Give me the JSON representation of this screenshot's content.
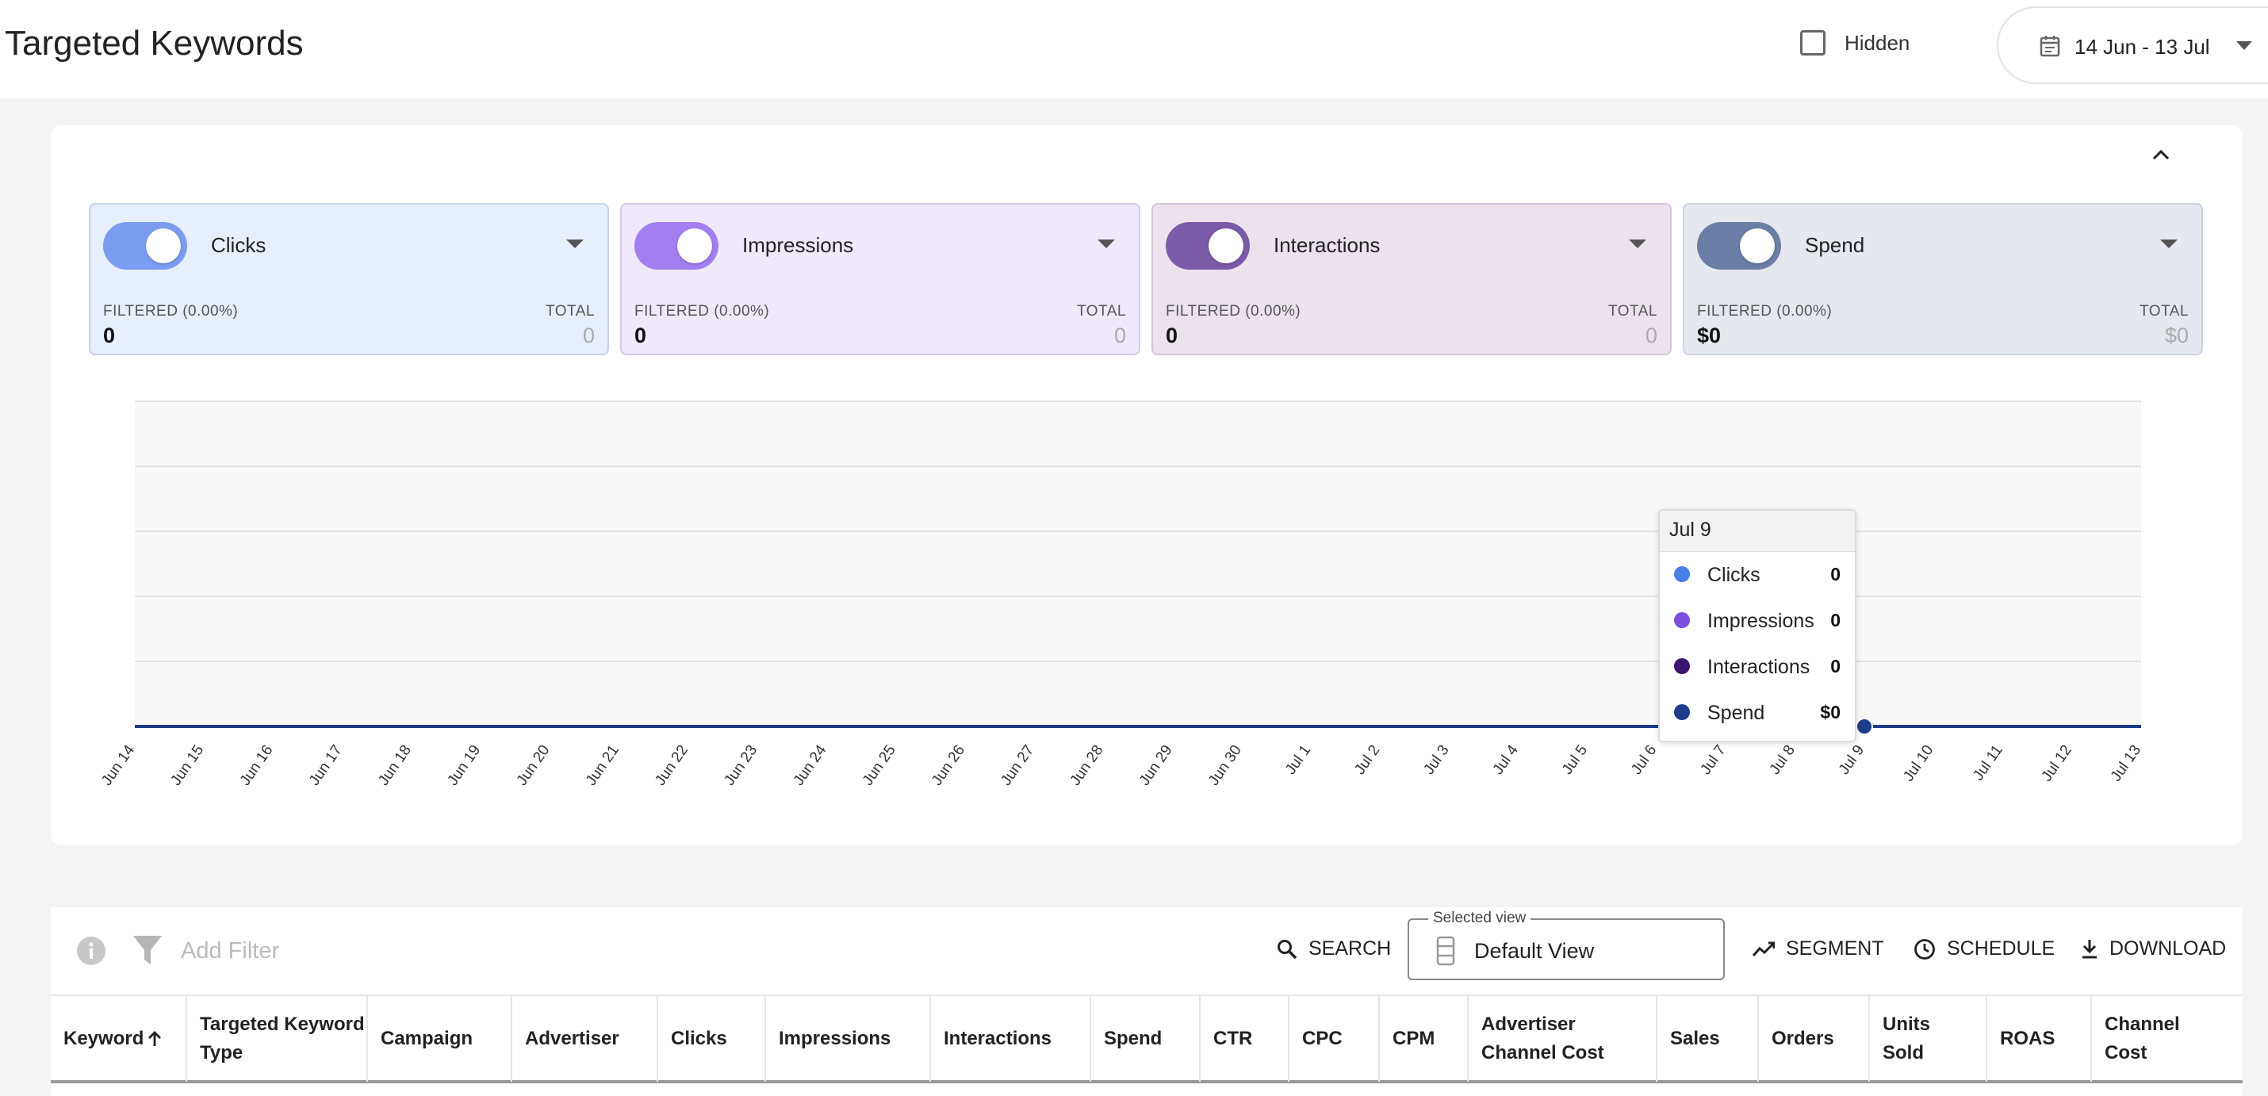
{
  "header": {
    "title": "Targeted Keywords",
    "hidden_label": "Hidden",
    "hidden_checked": false,
    "date_range": "14 Jun - 13 Jul"
  },
  "metrics": [
    {
      "name": "Clicks",
      "color": "#7b9cf0",
      "enabled": true,
      "filtered_label": "FILTERED (0.00%)",
      "filtered_value": "0",
      "total_label": "TOTAL",
      "total_value": "0"
    },
    {
      "name": "Impressions",
      "color": "#a27ff0",
      "enabled": true,
      "filtered_label": "FILTERED (0.00%)",
      "filtered_value": "0",
      "total_label": "TOTAL",
      "total_value": "0"
    },
    {
      "name": "Interactions",
      "color": "#7b5ba8",
      "enabled": true,
      "filtered_label": "FILTERED (0.00%)",
      "filtered_value": "0",
      "total_label": "TOTAL",
      "total_value": "0"
    },
    {
      "name": "Spend",
      "color": "#6b7fa6",
      "enabled": true,
      "filtered_label": "FILTERED (0.00%)",
      "filtered_value": "$0",
      "total_label": "TOTAL",
      "total_value": "$0"
    }
  ],
  "chart_data": {
    "type": "line",
    "x": [
      "Jun 14",
      "Jun 15",
      "Jun 16",
      "Jun 17",
      "Jun 18",
      "Jun 19",
      "Jun 20",
      "Jun 21",
      "Jun 22",
      "Jun 23",
      "Jun 24",
      "Jun 25",
      "Jun 26",
      "Jun 27",
      "Jun 28",
      "Jun 29",
      "Jun 30",
      "Jul 1",
      "Jul 2",
      "Jul 3",
      "Jul 4",
      "Jul 5",
      "Jul 6",
      "Jul 7",
      "Jul 8",
      "Jul 9",
      "Jul 10",
      "Jul 11",
      "Jul 12",
      "Jul 13"
    ],
    "series": [
      {
        "name": "Clicks",
        "color": "#4a7fe8",
        "values": [
          0,
          0,
          0,
          0,
          0,
          0,
          0,
          0,
          0,
          0,
          0,
          0,
          0,
          0,
          0,
          0,
          0,
          0,
          0,
          0,
          0,
          0,
          0,
          0,
          0,
          0,
          0,
          0,
          0,
          0
        ]
      },
      {
        "name": "Impressions",
        "color": "#7b4fe0",
        "values": [
          0,
          0,
          0,
          0,
          0,
          0,
          0,
          0,
          0,
          0,
          0,
          0,
          0,
          0,
          0,
          0,
          0,
          0,
          0,
          0,
          0,
          0,
          0,
          0,
          0,
          0,
          0,
          0,
          0,
          0
        ]
      },
      {
        "name": "Interactions",
        "color": "#3b1470",
        "values": [
          0,
          0,
          0,
          0,
          0,
          0,
          0,
          0,
          0,
          0,
          0,
          0,
          0,
          0,
          0,
          0,
          0,
          0,
          0,
          0,
          0,
          0,
          0,
          0,
          0,
          0,
          0,
          0,
          0,
          0
        ]
      },
      {
        "name": "Spend",
        "color": "#1e3c8a",
        "values": [
          0,
          0,
          0,
          0,
          0,
          0,
          0,
          0,
          0,
          0,
          0,
          0,
          0,
          0,
          0,
          0,
          0,
          0,
          0,
          0,
          0,
          0,
          0,
          0,
          0,
          0,
          0,
          0,
          0,
          0
        ]
      }
    ],
    "grid": true,
    "highlighted_x": "Jul 9"
  },
  "tooltip": {
    "title": "Jul 9",
    "rows": [
      {
        "label": "Clicks",
        "value": "0",
        "color": "#4a7fe8"
      },
      {
        "label": "Impressions",
        "value": "0",
        "color": "#7b4fe0"
      },
      {
        "label": "Interactions",
        "value": "0",
        "color": "#3b1470"
      },
      {
        "label": "Spend",
        "value": "$0",
        "color": "#1e3c8a"
      }
    ]
  },
  "toolbar": {
    "add_filter_placeholder": "Add Filter",
    "search_label": "SEARCH",
    "view_legend": "Selected view",
    "view_value": "Default View",
    "segment_label": "SEGMENT",
    "schedule_label": "SCHEDULE",
    "download_label": "DOWNLOAD"
  },
  "table": {
    "columns": [
      "Keyword",
      "Targeted Keyword Type",
      "Campaign",
      "Advertiser",
      "Clicks",
      "Impressions",
      "Interactions",
      "Spend",
      "CTR",
      "CPC",
      "CPM",
      "Advertiser Channel Cost",
      "Sales",
      "Orders",
      "Units Sold",
      "ROAS",
      "Channel Cost"
    ],
    "sort_column": "Keyword",
    "sort_direction": "ascending"
  }
}
